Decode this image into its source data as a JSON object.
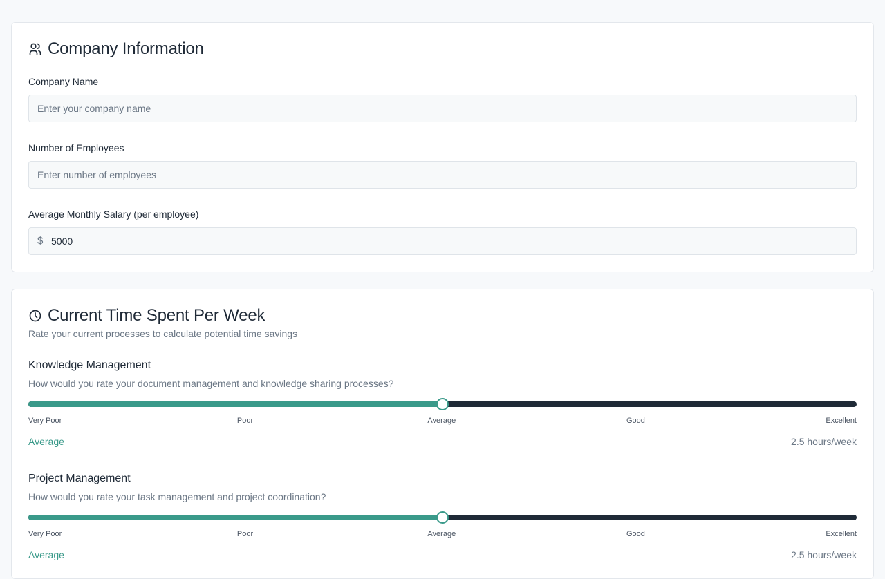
{
  "company_section": {
    "title": "Company Information",
    "icon": "users-icon",
    "company_name": {
      "label": "Company Name",
      "placeholder": "Enter your company name",
      "value": ""
    },
    "employees": {
      "label": "Number of Employees",
      "placeholder": "Enter number of employees",
      "value": ""
    },
    "salary": {
      "label": "Average Monthly Salary (per employee)",
      "prefix": "$",
      "value": "5000"
    }
  },
  "time_section": {
    "title": "Current Time Spent Per Week",
    "icon": "clock-icon",
    "subtitle": "Rate your current processes to calculate potential time savings",
    "scale_labels": [
      "Very Poor",
      "Poor",
      "Average",
      "Good",
      "Excellent"
    ],
    "questions": [
      {
        "title": "Knowledge Management",
        "description": "How would you rate your document management and knowledge sharing processes?",
        "level": 0.5,
        "rating": "Average",
        "hours": "2.5 hours/week"
      },
      {
        "title": "Project Management",
        "description": "How would you rate your task management and project coordination?",
        "level": 0.5,
        "rating": "Average",
        "hours": "2.5 hours/week"
      }
    ]
  },
  "colors": {
    "accent": "#3a9a8a",
    "track": "#1f2a37",
    "text": "#1f2a37",
    "muted": "#6b7785",
    "card_border": "#e3e7ec",
    "page_bg": "#f7f9fb"
  }
}
